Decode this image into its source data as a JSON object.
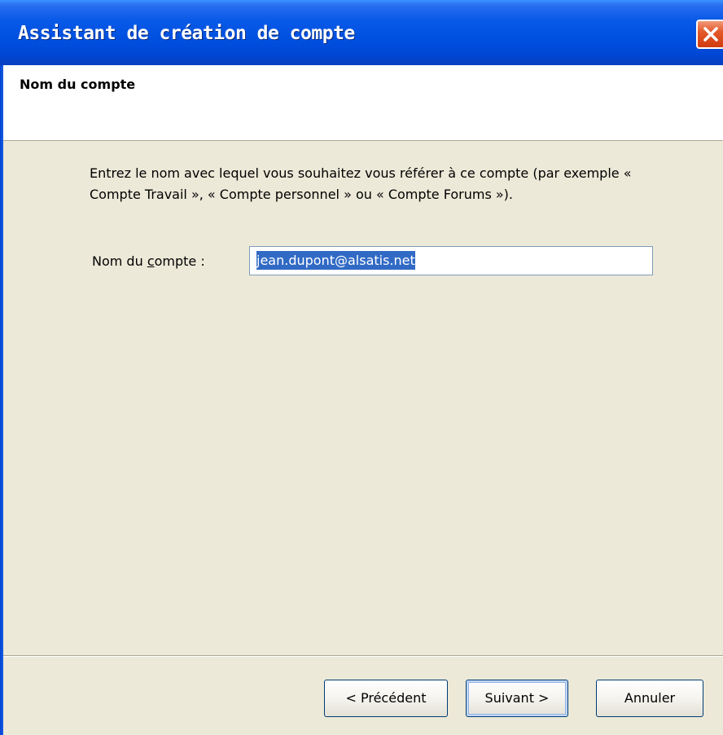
{
  "window": {
    "title": "Assistant de création de compte"
  },
  "header": {
    "title": "Nom du compte"
  },
  "content": {
    "description": "Entrez le nom avec lequel vous souhaitez vous référer à ce compte (par exemple « Compte Travail », « Compte personnel » ou « Compte Forums »).",
    "field_label_pre": "Nom du ",
    "field_label_accel": "c",
    "field_label_post": "ompte :",
    "account_name_value": "jean.dupont@alsatis.net"
  },
  "buttons": {
    "previous": "< Précédent",
    "next": "Suivant >",
    "cancel": "Annuler"
  },
  "icons": {
    "close": "close-icon"
  },
  "colors": {
    "titlebar": "#0050e0",
    "close_button": "#e45a2a",
    "selection": "#316ac5",
    "dialog_background": "#ece9d8"
  }
}
